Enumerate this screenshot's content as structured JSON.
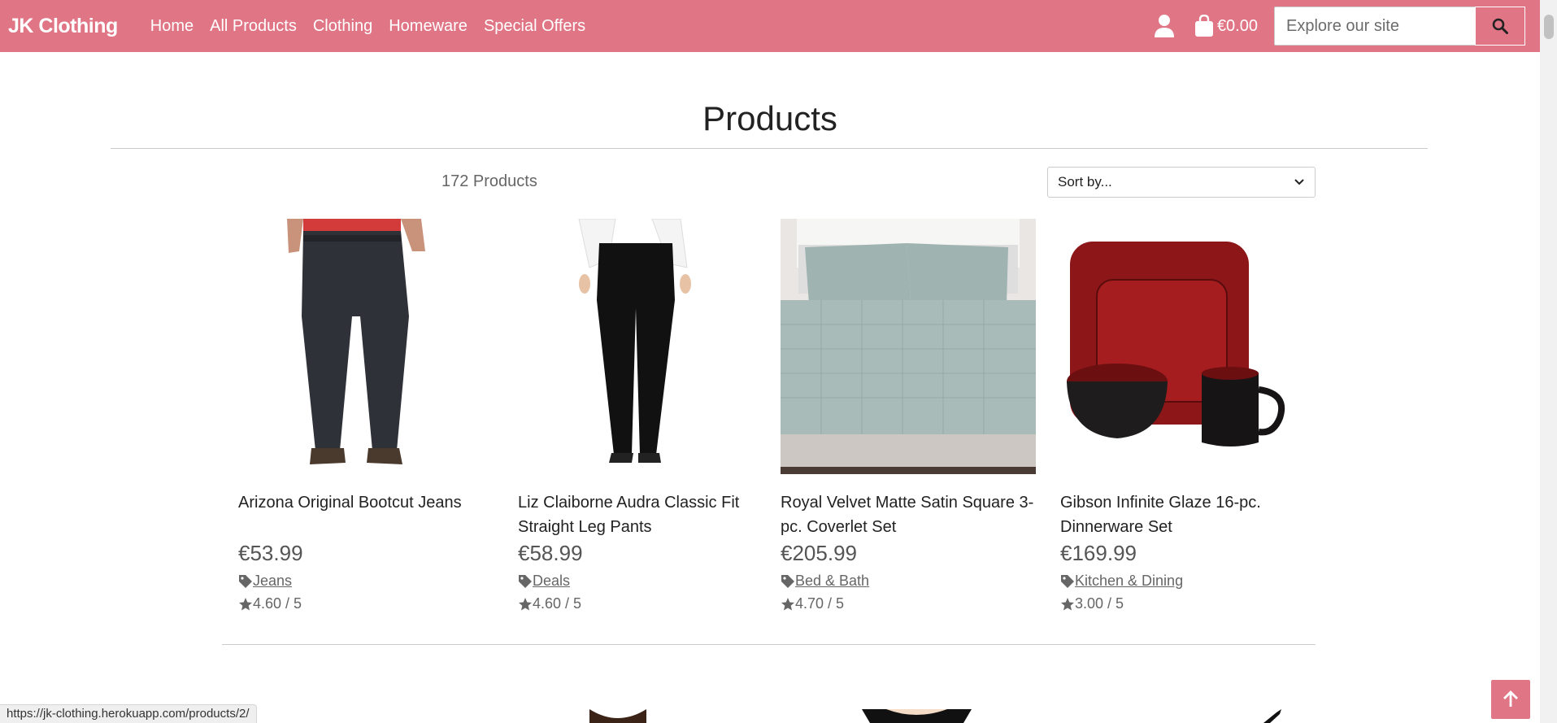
{
  "nav": {
    "brand": "JK Clothing",
    "links": [
      "Home",
      "All Products",
      "Clothing",
      "Homeware",
      "Special Offers"
    ],
    "cart_total": "€0.00",
    "search_placeholder": "Explore our site"
  },
  "page": {
    "title": "Products",
    "product_count": "172 Products",
    "sort_label": "Sort by..."
  },
  "products": [
    {
      "name": "Arizona Original Bootcut Jeans",
      "price": "€53.99",
      "category": "Jeans",
      "rating": "4.60 / 5"
    },
    {
      "name": "Liz Claiborne Audra Classic Fit Straight Leg Pants",
      "price": "€58.99",
      "category": "Deals",
      "rating": "4.60 / 5"
    },
    {
      "name": "Royal Velvet Matte Satin Square 3-pc. Coverlet Set",
      "price": "€205.99",
      "category": "Bed & Bath",
      "rating": "4.70 / 5"
    },
    {
      "name": "Gibson Infinite Glaze 16-pc. Dinnerware Set",
      "price": "€169.99",
      "category": "Kitchen & Dining",
      "rating": "3.00 / 5"
    }
  ],
  "status_url": "https://jk-clothing.herokuapp.com/products/2/",
  "colors": {
    "brand": "#e07585"
  }
}
